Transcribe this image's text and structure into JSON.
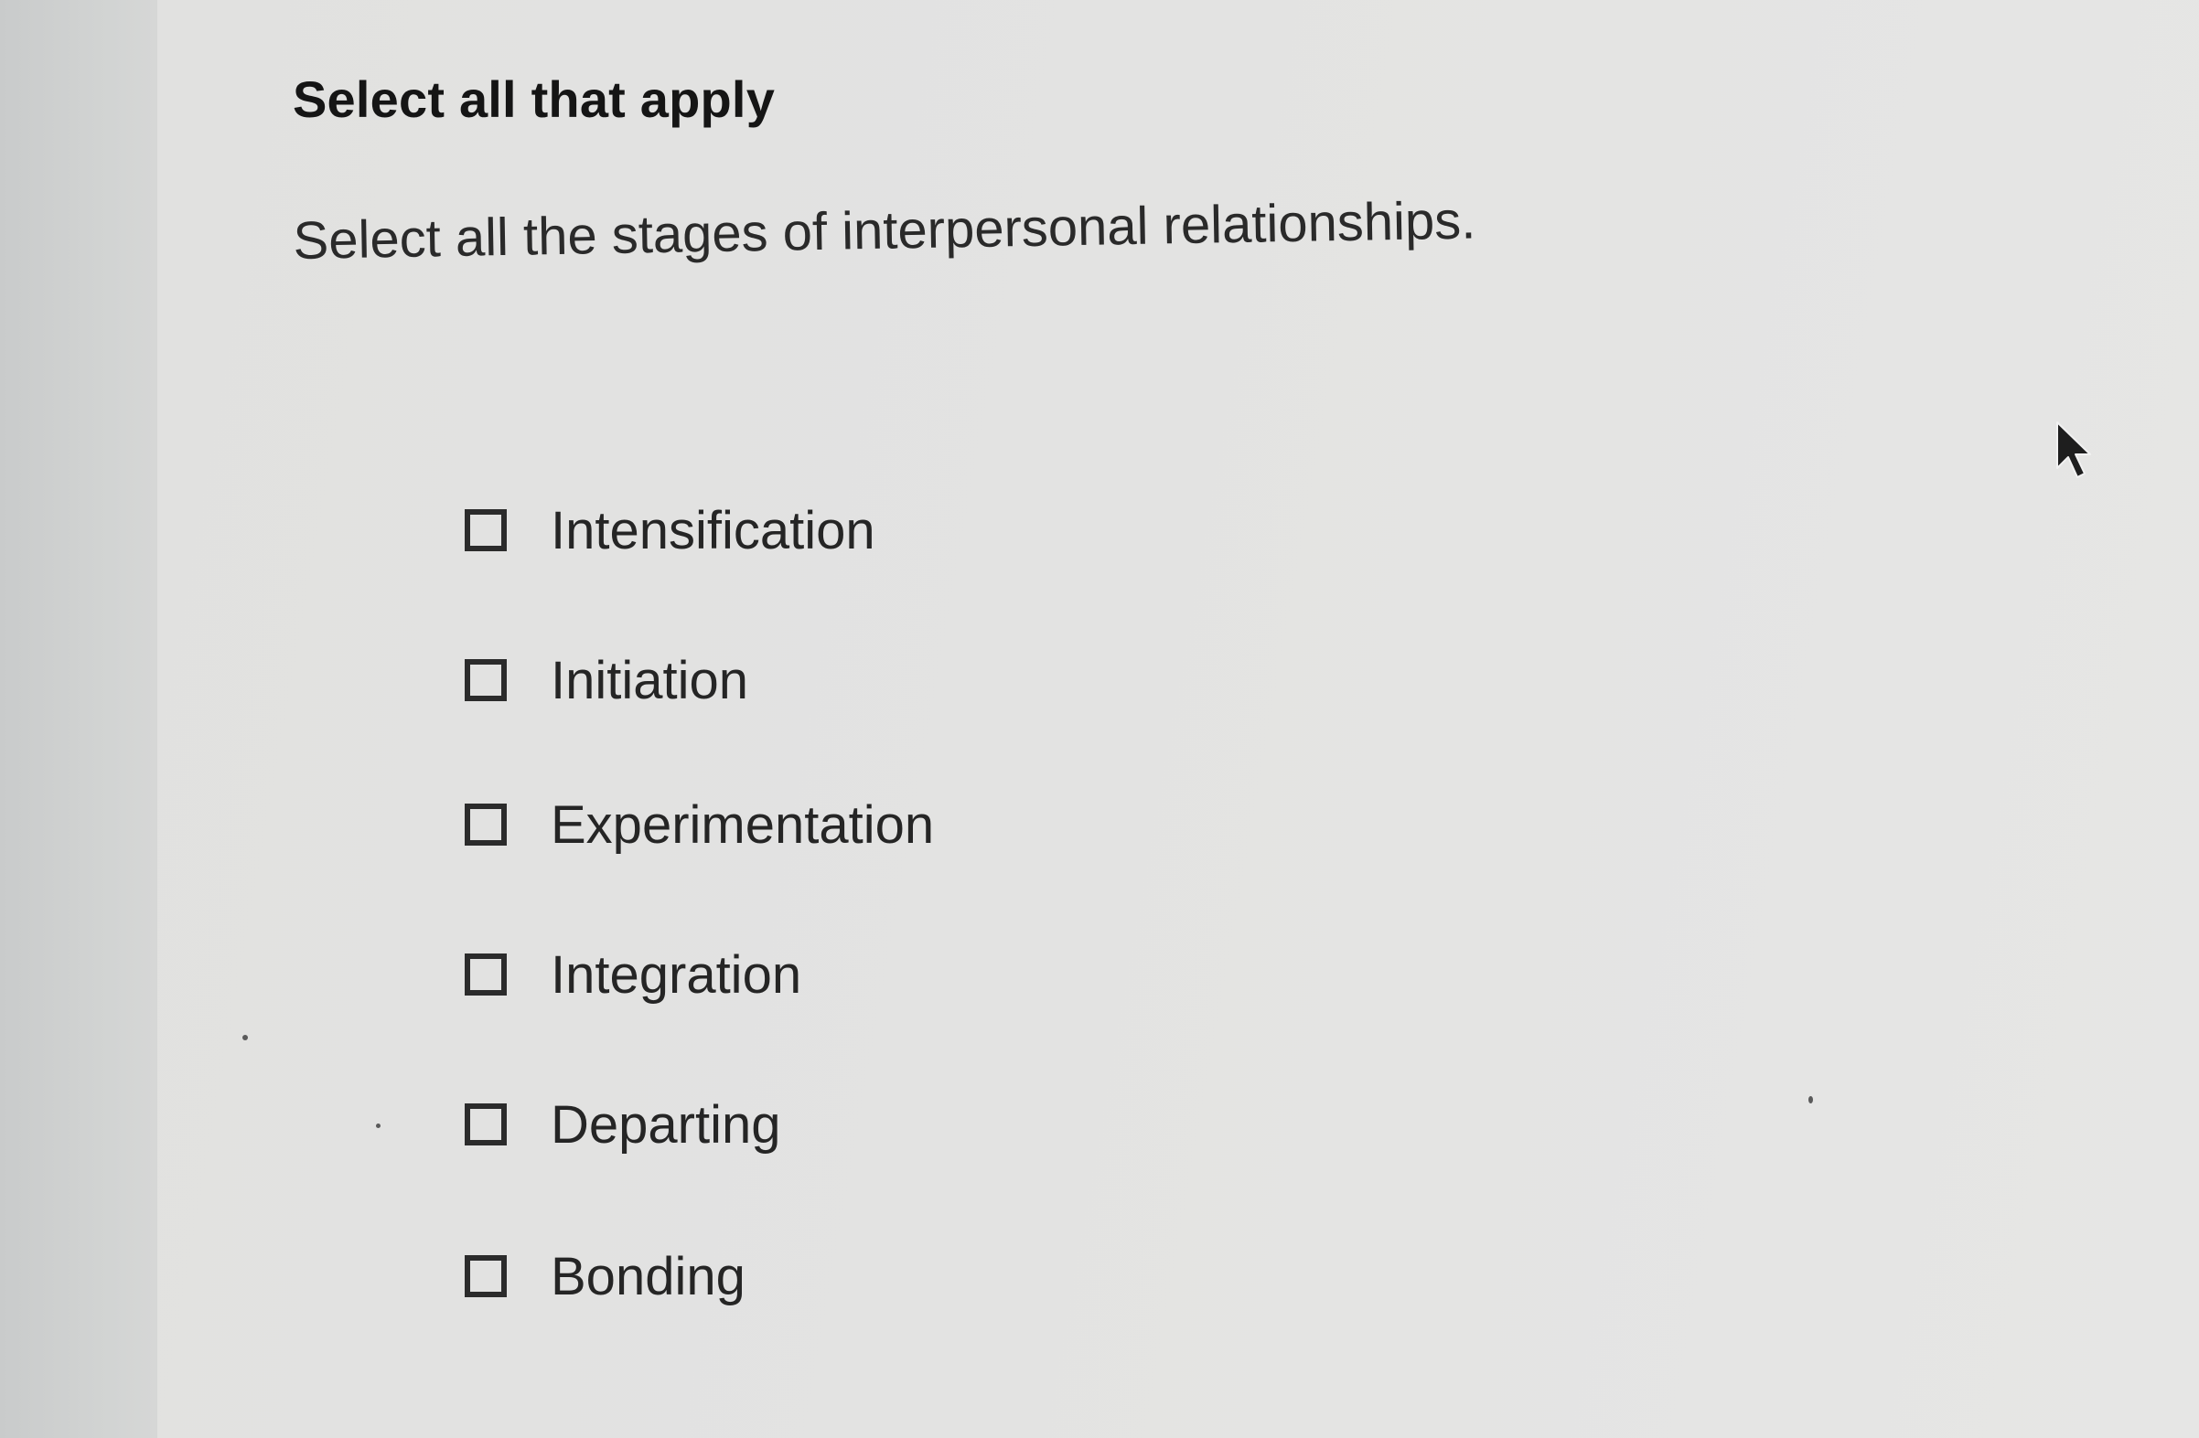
{
  "question": {
    "type_label": "Select all that apply",
    "prompt": "Select all the stages of interpersonal relationships."
  },
  "options": [
    {
      "label": "Intensification",
      "checked": false
    },
    {
      "label": "Initiation",
      "checked": false
    },
    {
      "label": "Experimentation",
      "checked": false
    },
    {
      "label": "Integration",
      "checked": false
    },
    {
      "label": "Departing",
      "checked": false
    },
    {
      "label": "Bonding",
      "checked": false
    }
  ],
  "icons": {
    "cursor": "mouse-pointer-icon",
    "checkbox": "checkbox-unchecked-icon"
  },
  "colors": {
    "text": "#252525",
    "checkbox_border": "#2b2b2b",
    "background": "#e3e3e2"
  }
}
